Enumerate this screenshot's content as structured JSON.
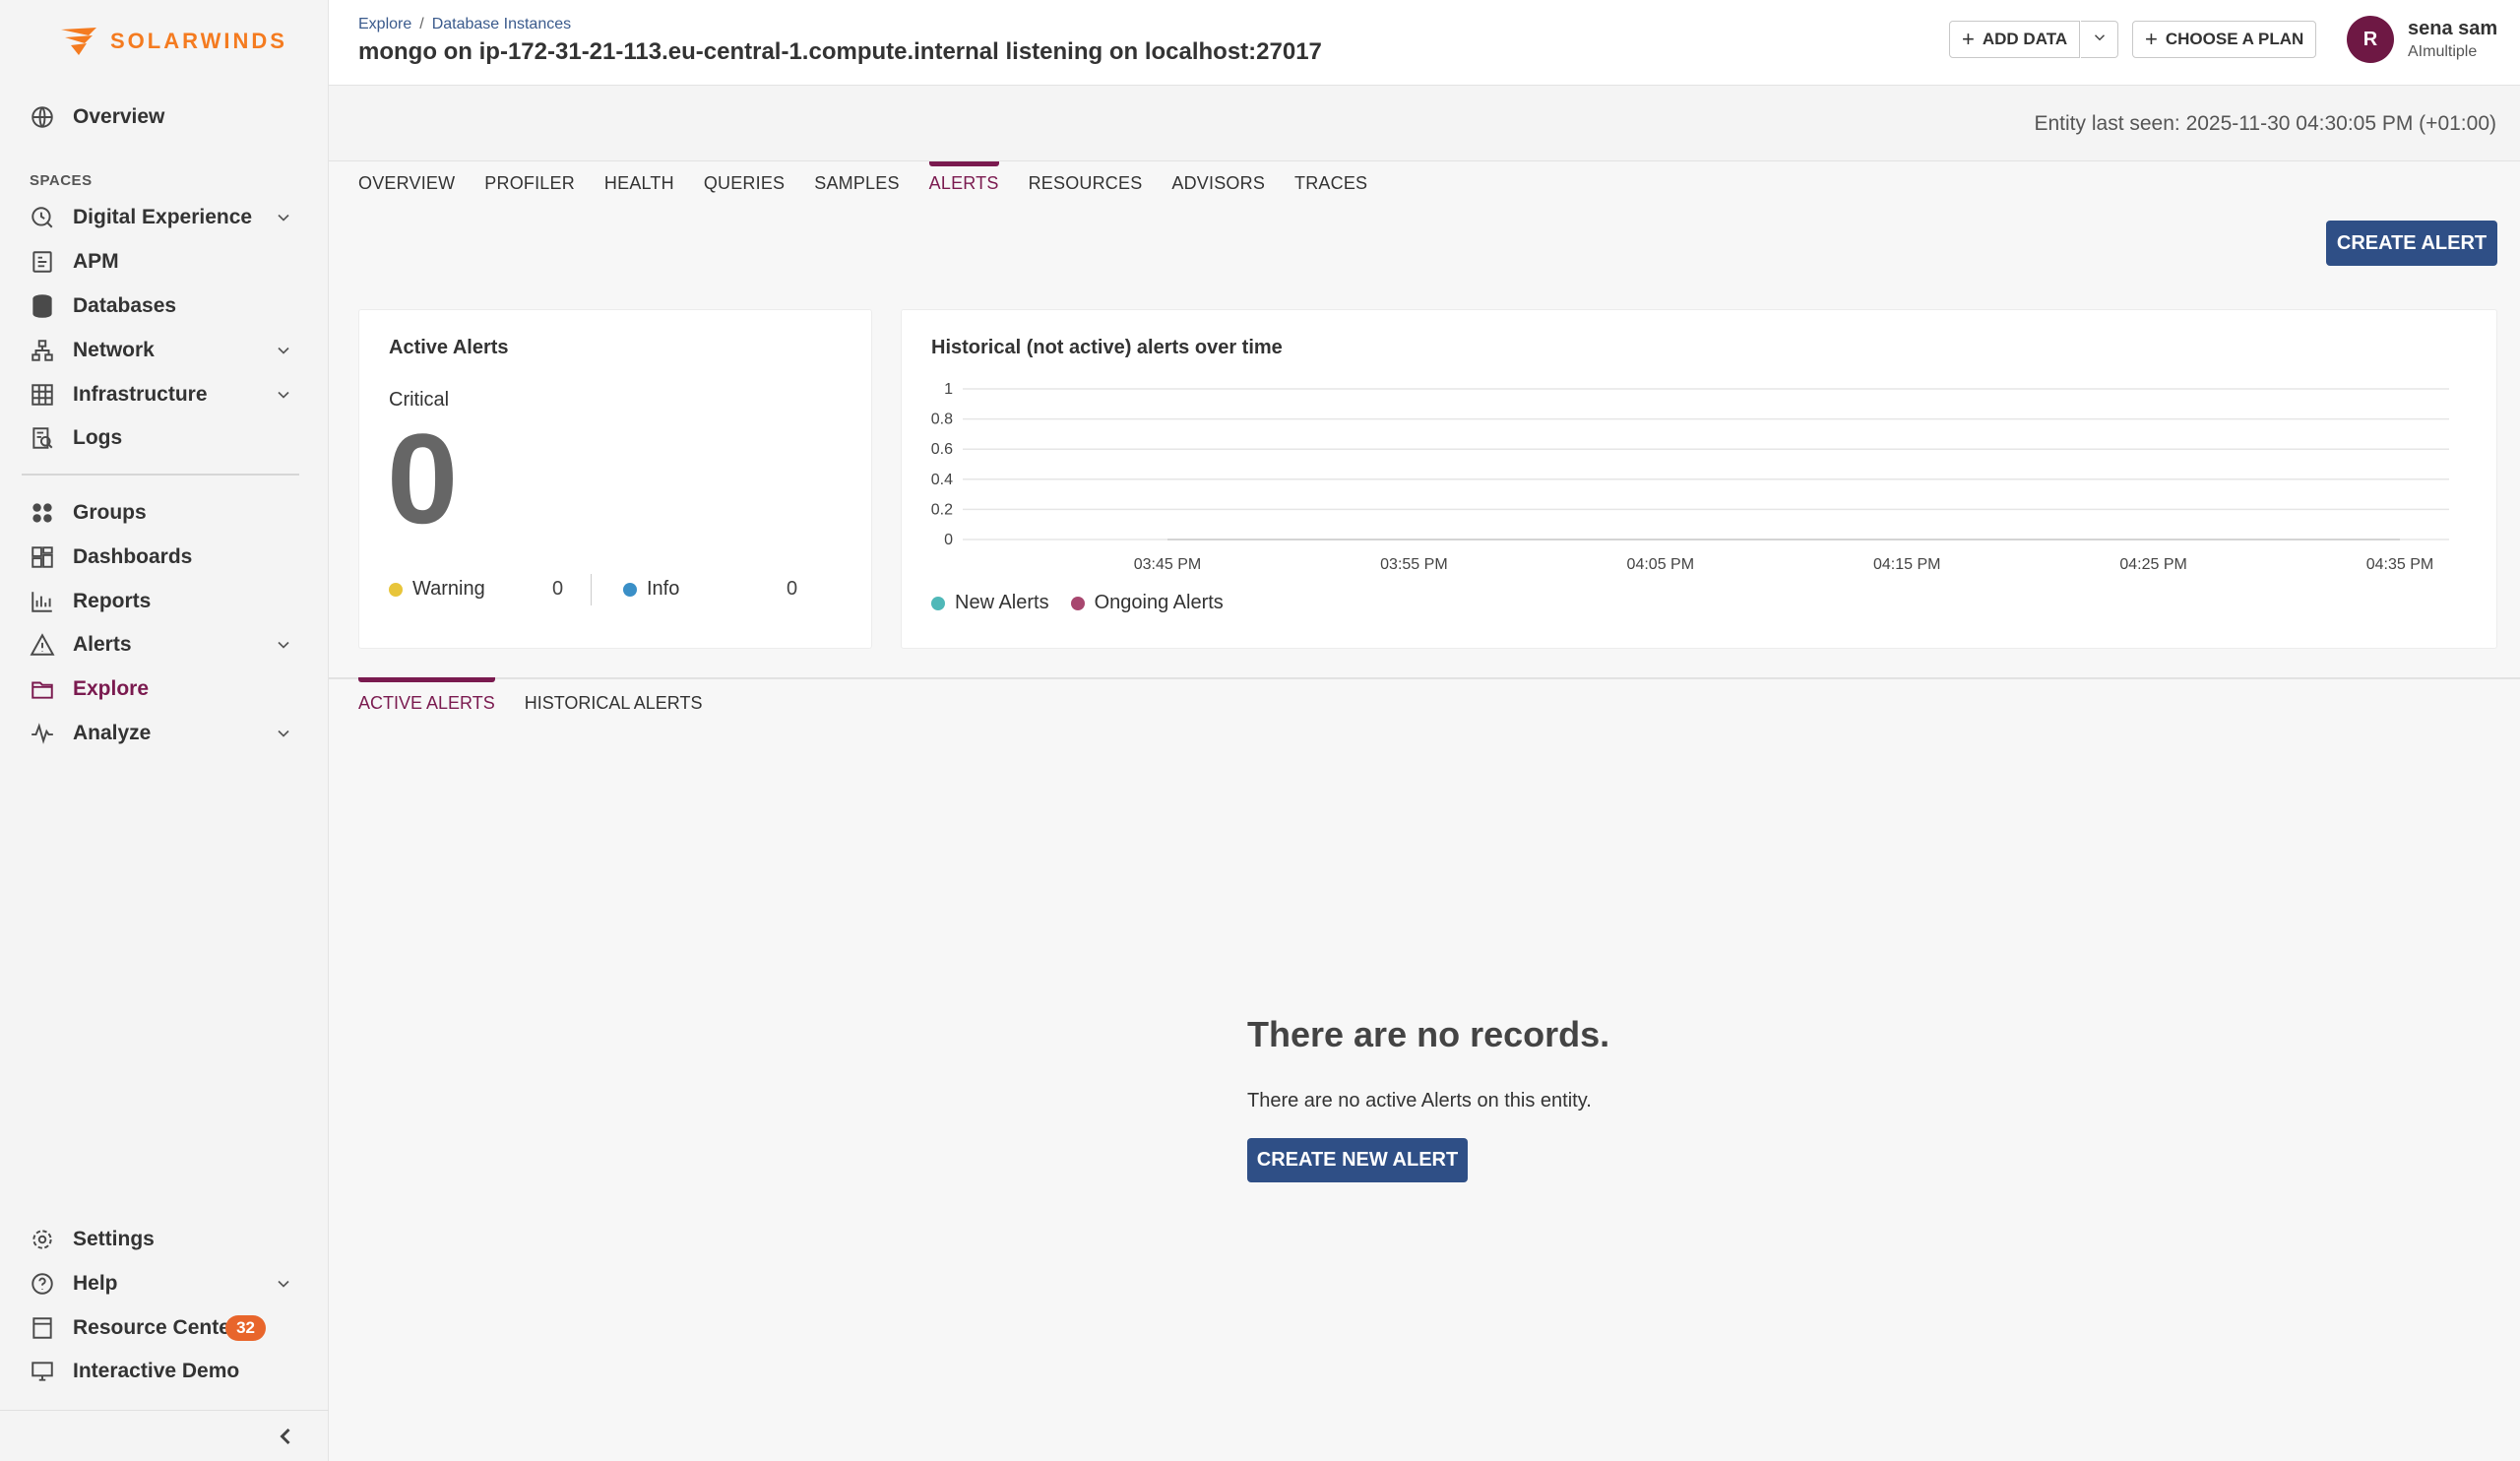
{
  "brand": {
    "name": "SOLARWINDS",
    "color": "#f47b20"
  },
  "sidebar": {
    "top_item": {
      "label": "Overview",
      "icon": "globe-icon"
    },
    "spaces_label": "SPACES",
    "items": [
      {
        "label": "Digital Experience",
        "icon": "digital-experience-icon",
        "expandable": true
      },
      {
        "label": "APM",
        "icon": "apm-icon",
        "expandable": false
      },
      {
        "label": "Databases",
        "icon": "database-icon",
        "expandable": false
      },
      {
        "label": "Network",
        "icon": "network-icon",
        "expandable": true
      },
      {
        "label": "Infrastructure",
        "icon": "grid-icon",
        "expandable": true
      },
      {
        "label": "Logs",
        "icon": "logs-icon",
        "expandable": false
      }
    ],
    "items2": [
      {
        "label": "Groups",
        "icon": "groups-icon"
      },
      {
        "label": "Dashboards",
        "icon": "dashboards-icon"
      },
      {
        "label": "Reports",
        "icon": "reports-icon"
      },
      {
        "label": "Alerts",
        "icon": "warning-triangle-icon",
        "expandable": true
      },
      {
        "label": "Explore",
        "icon": "folder-icon",
        "active": true
      },
      {
        "label": "Analyze",
        "icon": "pulse-icon",
        "expandable": true
      }
    ],
    "bottom": [
      {
        "label": "Settings",
        "icon": "gear-icon"
      },
      {
        "label": "Help",
        "icon": "help-icon",
        "expandable": true
      },
      {
        "label": "Resource Center",
        "icon": "book-icon",
        "badge": "32"
      },
      {
        "label": "Interactive Demo",
        "icon": "monitor-icon"
      }
    ]
  },
  "header": {
    "breadcrumb": [
      "Explore",
      "Database Instances"
    ],
    "breadcrumb_sep": "/",
    "title": "mongo on ip-172-31-21-113.eu-central-1.compute.internal listening on localhost:27017",
    "add_data": "ADD DATA",
    "choose_plan": "CHOOSE A PLAN",
    "user": {
      "initial": "R",
      "name": "sena sam",
      "org": "AImultiple"
    }
  },
  "last_seen": "Entity last seen: 2025-11-30 04:30:05 PM (+01:00)",
  "tabs": [
    "OVERVIEW",
    "PROFILER",
    "HEALTH",
    "QUERIES",
    "SAMPLES",
    "ALERTS",
    "RESOURCES",
    "ADVISORS",
    "TRACES"
  ],
  "active_tab": "ALERTS",
  "create_alert": "CREATE ALERT",
  "active_alerts": {
    "title": "Active Alerts",
    "critical_label": "Critical",
    "critical_value": "0",
    "warning_label": "Warning",
    "warning_value": "0",
    "info_label": "Info",
    "info_value": "0",
    "warning_color": "#e8c53a",
    "info_color": "#3a8fc7"
  },
  "historical": {
    "title": "Historical (not active) alerts over time"
  },
  "chart_data": {
    "type": "line",
    "x": [
      "03:45 PM",
      "03:55 PM",
      "04:05 PM",
      "04:15 PM",
      "04:25 PM",
      "04:35 PM"
    ],
    "yticks": [
      "1",
      "0.8",
      "0.6",
      "0.4",
      "0.2",
      "0"
    ],
    "ylim": [
      0,
      1
    ],
    "series": [
      {
        "name": "New Alerts",
        "color": "#4fb8b8",
        "values": [
          0,
          0,
          0,
          0,
          0,
          0
        ]
      },
      {
        "name": "Ongoing Alerts",
        "color": "#a8476f",
        "values": [
          0,
          0,
          0,
          0,
          0,
          0
        ]
      }
    ],
    "grid": true,
    "legend": "bottom-left"
  },
  "lower_tabs": [
    "ACTIVE ALERTS",
    "HISTORICAL ALERTS"
  ],
  "empty": {
    "title": "There are no records.",
    "text": "There are no active Alerts on this entity.",
    "button": "CREATE NEW ALERT"
  }
}
